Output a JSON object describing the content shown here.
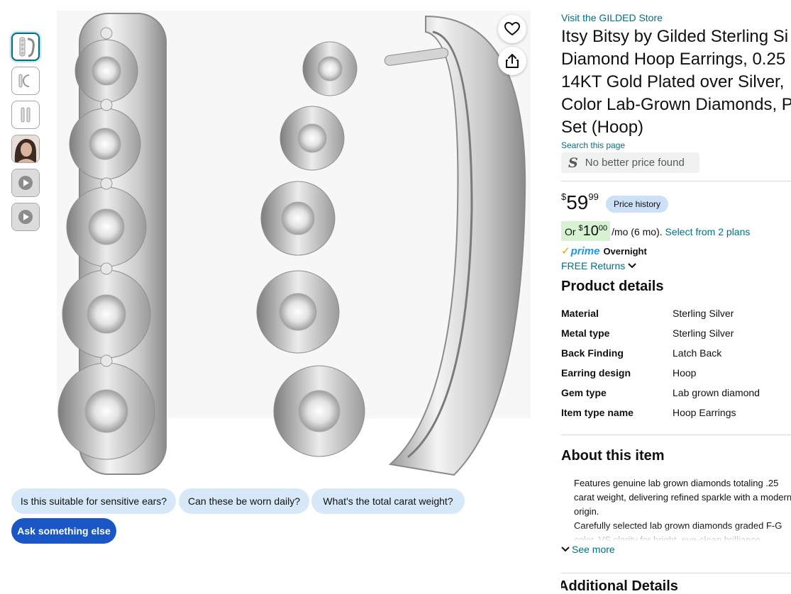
{
  "gallery": {
    "thumbnails": [
      {
        "kind": "image",
        "selected": true
      },
      {
        "kind": "image",
        "selected": false
      },
      {
        "kind": "image",
        "selected": false
      },
      {
        "kind": "image",
        "selected": false
      },
      {
        "kind": "video",
        "selected": false
      },
      {
        "kind": "video",
        "selected": false
      }
    ]
  },
  "image_actions": {
    "favorite_icon": "heart-icon",
    "share_icon": "share-icon"
  },
  "questions": {
    "chips": [
      "Is this suitable for sensitive ears?",
      "Can these be worn daily?",
      "What's the total carat weight?"
    ],
    "ask_else": "Ask something else"
  },
  "product": {
    "store_link": "Visit the GILDED Store",
    "title_lines": [
      "Itsy Bitsy by Gilded Sterling Si",
      "Diamond Hoop Earrings, 0.25",
      "14KT Gold Plated over Silver,",
      "Color Lab-Grown Diamonds, P",
      "Set (Hoop)"
    ],
    "search_page": "Search this page",
    "no_better_price": "No better price found",
    "price": {
      "symbol": "$",
      "whole": "59",
      "fraction": "99"
    },
    "price_history": "Price history",
    "installment": {
      "prefix": "Or",
      "symbol": "$",
      "whole": "10",
      "fraction": "00",
      "suffix": "/mo (6 mo).",
      "link": "Select from 2 plans"
    },
    "delivery": {
      "prime": "prime",
      "speed": "Overnight"
    },
    "returns": "FREE Returns"
  },
  "details": {
    "heading": "Product details",
    "rows": [
      {
        "label": "Material",
        "value": "Sterling Silver"
      },
      {
        "label": "Metal type",
        "value": "Sterling Silver"
      },
      {
        "label": "Back Finding",
        "value": "Latch Back"
      },
      {
        "label": "Earring design",
        "value": "Hoop"
      },
      {
        "label": "Gem type",
        "value": "Lab grown diamond"
      },
      {
        "label": "Item type name",
        "value": "Hoop Earrings"
      }
    ]
  },
  "about": {
    "heading": "About this item",
    "bullets": [
      "Features genuine lab grown diamonds totaling .25 carat weight, delivering refined sparkle with a modern origin.",
      "Carefully selected lab grown diamonds graded F-G color, VS clarity for bright, eye-clean brilliance."
    ],
    "see_more": "See more"
  },
  "next_section_heading": "Additional Details",
  "colors": {
    "link": "#007185",
    "chip_bg": "#d7e8f8",
    "chip_primary_bg": "#1a56c6",
    "price_history_bg": "#cce0f7",
    "installment_bg": "#d6f2d3",
    "prime_blue": "#1a98ff",
    "prime_check": "#ff9900"
  }
}
